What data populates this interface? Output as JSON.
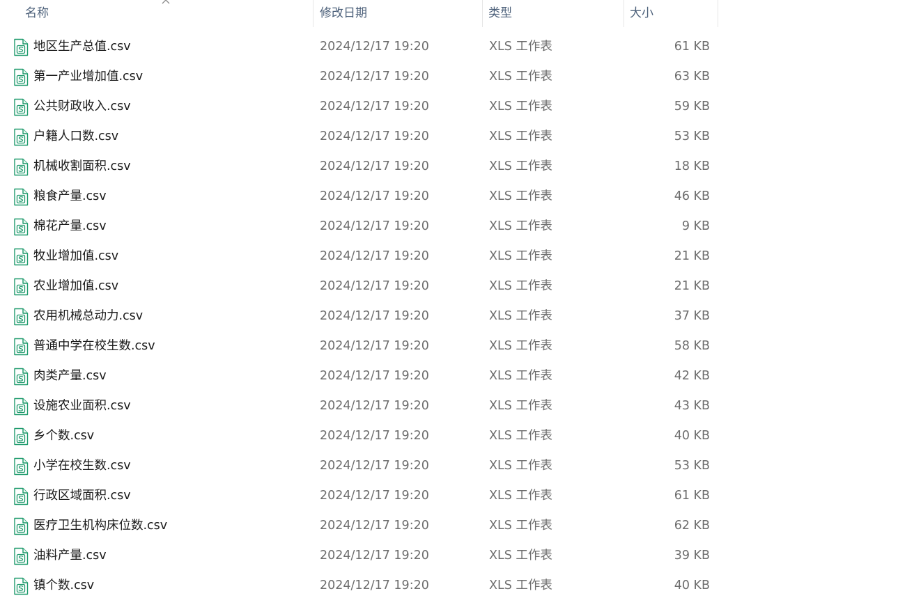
{
  "columns": {
    "name": "名称",
    "date": "修改日期",
    "type": "类型",
    "size": "大小"
  },
  "icon": {
    "name": "spreadsheet-s-icon",
    "accent": "#1e9a6c",
    "fold": "#e9f6ef"
  },
  "files": [
    {
      "name": "地区生产总值.csv",
      "date": "2024/12/17 19:20",
      "type": "XLS 工作表",
      "size": "61 KB"
    },
    {
      "name": "第一产业增加值.csv",
      "date": "2024/12/17 19:20",
      "type": "XLS 工作表",
      "size": "63 KB"
    },
    {
      "name": "公共财政收入.csv",
      "date": "2024/12/17 19:20",
      "type": "XLS 工作表",
      "size": "59 KB"
    },
    {
      "name": "户籍人口数.csv",
      "date": "2024/12/17 19:20",
      "type": "XLS 工作表",
      "size": "53 KB"
    },
    {
      "name": "机械收割面积.csv",
      "date": "2024/12/17 19:20",
      "type": "XLS 工作表",
      "size": "18 KB"
    },
    {
      "name": "粮食产量.csv",
      "date": "2024/12/17 19:20",
      "type": "XLS 工作表",
      "size": "46 KB"
    },
    {
      "name": "棉花产量.csv",
      "date": "2024/12/17 19:20",
      "type": "XLS 工作表",
      "size": "9 KB"
    },
    {
      "name": "牧业增加值.csv",
      "date": "2024/12/17 19:20",
      "type": "XLS 工作表",
      "size": "21 KB"
    },
    {
      "name": "农业增加值.csv",
      "date": "2024/12/17 19:20",
      "type": "XLS 工作表",
      "size": "21 KB"
    },
    {
      "name": "农用机械总动力.csv",
      "date": "2024/12/17 19:20",
      "type": "XLS 工作表",
      "size": "37 KB"
    },
    {
      "name": "普通中学在校生数.csv",
      "date": "2024/12/17 19:20",
      "type": "XLS 工作表",
      "size": "58 KB"
    },
    {
      "name": "肉类产量.csv",
      "date": "2024/12/17 19:20",
      "type": "XLS 工作表",
      "size": "42 KB"
    },
    {
      "name": "设施农业面积.csv",
      "date": "2024/12/17 19:20",
      "type": "XLS 工作表",
      "size": "43 KB"
    },
    {
      "name": "乡个数.csv",
      "date": "2024/12/17 19:20",
      "type": "XLS 工作表",
      "size": "40 KB"
    },
    {
      "name": "小学在校生数.csv",
      "date": "2024/12/17 19:20",
      "type": "XLS 工作表",
      "size": "53 KB"
    },
    {
      "name": "行政区域面积.csv",
      "date": "2024/12/17 19:20",
      "type": "XLS 工作表",
      "size": "61 KB"
    },
    {
      "name": "医疗卫生机构床位数.csv",
      "date": "2024/12/17 19:20",
      "type": "XLS 工作表",
      "size": "62 KB"
    },
    {
      "name": "油料产量.csv",
      "date": "2024/12/17 19:20",
      "type": "XLS 工作表",
      "size": "39 KB"
    },
    {
      "name": "镇个数.csv",
      "date": "2024/12/17 19:20",
      "type": "XLS 工作表",
      "size": "40 KB"
    }
  ]
}
